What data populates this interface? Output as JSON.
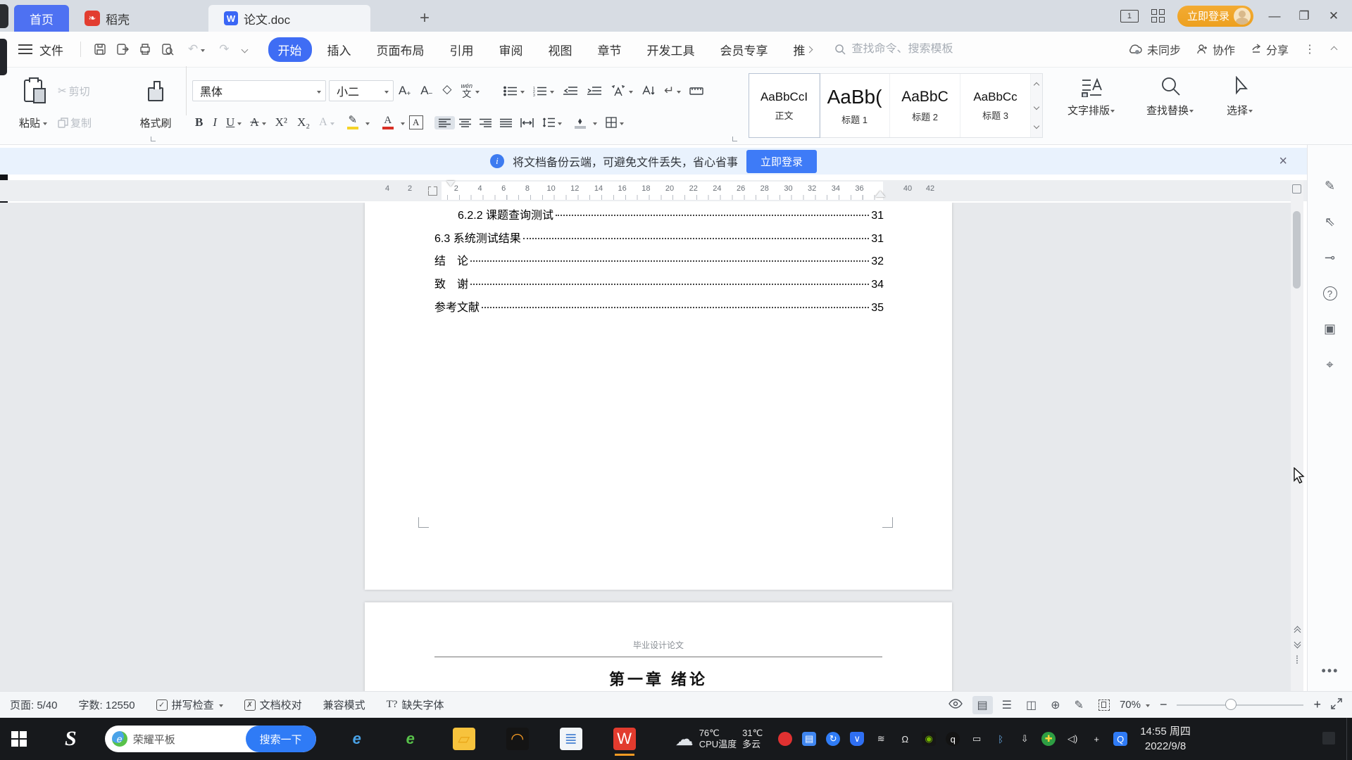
{
  "colors": {
    "accent": "#3f6df4",
    "login_orange": "#eda01f",
    "docer_red": "#e23d30",
    "wps_red": "#e23b2e",
    "notice_bg": "#e9f2fd",
    "taskbar_bg": "#17191c"
  },
  "tabbar": {
    "home": "首页",
    "docer": "稻壳",
    "doc_title": "论文.doc",
    "login": "立即登录"
  },
  "menubar": {
    "file": "文件",
    "tabs": [
      {
        "label": "开始",
        "cls": "active"
      },
      {
        "label": "插入",
        "cls": ""
      },
      {
        "label": "页面布局",
        "cls": ""
      },
      {
        "label": "引用",
        "cls": ""
      },
      {
        "label": "审阅",
        "cls": ""
      },
      {
        "label": "视图",
        "cls": ""
      },
      {
        "label": "章节",
        "cls": ""
      },
      {
        "label": "开发工具",
        "cls": ""
      },
      {
        "label": "会员专享",
        "cls": ""
      },
      {
        "label": "推",
        "cls": "truncated"
      }
    ],
    "search_placeholder": "查找命令、搜索模板",
    "sync": "未同步",
    "collab": "协作",
    "share": "分享"
  },
  "ribbon": {
    "paste": "粘贴",
    "cut": "剪切",
    "copy": "复制",
    "painter": "格式刷",
    "font_name": "黑体",
    "font_size": "小二",
    "pinyin_top": "wén",
    "pinyin_bottom": "文",
    "styles": [
      {
        "sample": "AaBbCcI",
        "label": "正文",
        "cls": "sel"
      },
      {
        "sample": "AaBb(",
        "label": "标题 1",
        "cls": "s1"
      },
      {
        "sample": "AaBbC",
        "label": "标题 2",
        "cls": "s2"
      },
      {
        "sample": "AaBbCc",
        "label": "标题 3",
        "cls": "s3"
      }
    ],
    "typeset": "文字排版",
    "find": "查找替换",
    "select": "选择"
  },
  "notice": {
    "info_text": "将文档备份云端，可避免文件丢失，省心省事",
    "login_button": "立即登录"
  },
  "ruler": {
    "left_nums": [
      "4",
      "2"
    ],
    "page_nums": [
      "2",
      "4",
      "6",
      "8",
      "10",
      "12",
      "14",
      "16",
      "18",
      "20",
      "22",
      "24",
      "26",
      "28",
      "30",
      "32",
      "34",
      "36"
    ],
    "right_nums": [
      "40",
      "42"
    ]
  },
  "document": {
    "toc": [
      {
        "title": "6.2.2  课题查询测试",
        "page": "31",
        "cls": "ind"
      },
      {
        "title": "6.3 系统测试结果",
        "page": "31",
        "cls": ""
      },
      {
        "title": "结　论",
        "page": "32",
        "cls": ""
      },
      {
        "title": "致　谢",
        "page": "34",
        "cls": ""
      },
      {
        "title": "参考文献",
        "page": "35",
        "cls": ""
      }
    ],
    "page2_header": "毕业设计论文",
    "page2_heading": "第一章  绪论"
  },
  "statusbar": {
    "page_info": "页面: 5/40",
    "word_count": "字数: 12550",
    "spell": "拼写检查",
    "proofread": "文档校对",
    "compat": "兼容模式",
    "missing_font": "缺失字体",
    "zoom_level": "70%",
    "view_icons": [
      {
        "name": "page-view-icon",
        "glyph": "▤",
        "cls": "sel"
      },
      {
        "name": "outline-view-icon",
        "glyph": "☰",
        "cls": ""
      },
      {
        "name": "read-layout-icon",
        "glyph": "◫",
        "cls": ""
      },
      {
        "name": "web-layout-icon",
        "glyph": "⊕",
        "cls": ""
      },
      {
        "name": "ink-annotation-icon",
        "glyph": "✎",
        "cls": ""
      }
    ]
  },
  "taskbar": {
    "device": "荣耀平板",
    "search_button": "搜索一下",
    "apps": [
      {
        "name": "taskbar-app-ie",
        "glyph": "e",
        "bg": "transparent",
        "color": "#4aa3e8",
        "cls": "italic"
      },
      {
        "name": "taskbar-app-browser",
        "glyph": "e",
        "bg": "transparent",
        "color": "#58c24a",
        "cls": "italic"
      },
      {
        "name": "taskbar-app-explorer",
        "glyph": "▱",
        "bg": "#f7c33d",
        "color": "#e8a416",
        "cls": ""
      },
      {
        "name": "taskbar-app-media",
        "glyph": "◠",
        "bg": "#141414",
        "color": "#f59a23",
        "cls": ""
      },
      {
        "name": "taskbar-app-notepad",
        "glyph": "≣",
        "bg": "#f2f5f8",
        "color": "#5b8fd6",
        "cls": ""
      },
      {
        "name": "taskbar-app-wps",
        "glyph": "W",
        "bg": "#e23b2e",
        "color": "#ffffff",
        "cls": "active"
      }
    ],
    "weather": {
      "cpu_temp": "76℃",
      "cpu_label": "CPU温度",
      "temp": "31℃",
      "cond": "多云"
    },
    "tray": [
      {
        "name": "tray-antivirus-icon",
        "glyph": "",
        "bg": "#e03131",
        "color": "#fff",
        "shape": "circle"
      },
      {
        "name": "tray-usb-tool-icon",
        "glyph": "▤",
        "bg": "#3f86f0",
        "color": "#fff",
        "shape": "round"
      },
      {
        "name": "tray-sync-icon",
        "glyph": "↻",
        "bg": "#2f7cf6",
        "color": "#fff",
        "shape": "circle"
      },
      {
        "name": "tray-security-shield-icon",
        "glyph": "∨",
        "bg": "#2f6ff2",
        "color": "#fff",
        "shape": "shield"
      },
      {
        "name": "tray-signal-icon",
        "glyph": "≋",
        "bg": "transparent",
        "color": "#e8e8e8",
        "shape": ""
      },
      {
        "name": "tray-bell-icon",
        "glyph": "Ω",
        "bg": "transparent",
        "color": "#e8e8e8",
        "shape": ""
      },
      {
        "name": "tray-nvidia-icon",
        "glyph": "◉",
        "bg": "#161616",
        "color": "#76b900",
        "shape": "round"
      },
      {
        "name": "tray-qq-icon",
        "glyph": "q",
        "bg": "#131313",
        "color": "#fff",
        "shape": "circle"
      },
      {
        "name": "tray-power-icon",
        "glyph": "▭",
        "bg": "transparent",
        "color": "#e8e8e8",
        "shape": ""
      },
      {
        "name": "tray-bluetooth-icon",
        "glyph": "ᛒ",
        "bg": "transparent",
        "color": "#6db4f2",
        "shape": ""
      },
      {
        "name": "tray-usb-eject-icon",
        "glyph": "⇩",
        "bg": "transparent",
        "color": "#e8e8e8",
        "shape": ""
      },
      {
        "name": "tray-duba-icon",
        "glyph": "✚",
        "bg": "#2e9e43",
        "color": "#ffd43b",
        "shape": "circle"
      },
      {
        "name": "tray-volume-icon",
        "glyph": "◁)",
        "bg": "transparent",
        "color": "#e8e8e8",
        "shape": ""
      },
      {
        "name": "tray-crosshair-icon",
        "glyph": "+",
        "bg": "transparent",
        "color": "#e8e8e8",
        "shape": ""
      },
      {
        "name": "tray-qq-browser-icon",
        "glyph": "Q",
        "bg": "#2f7bf6",
        "color": "#fff",
        "shape": "round"
      }
    ],
    "clock_time": "14:55 周四",
    "clock_date": "2022/9/8"
  },
  "rightpanel": {
    "icons": [
      {
        "name": "annotate-pen-icon",
        "glyph": "✎",
        "cls": ""
      },
      {
        "name": "select-cursor-icon",
        "glyph": "⇖",
        "cls": ""
      },
      {
        "name": "measure-icon",
        "glyph": "⊸",
        "cls": ""
      },
      {
        "name": "help-icon",
        "glyph": "?",
        "cls": "circled"
      },
      {
        "name": "image-to-text-icon",
        "glyph": "▣",
        "cls": ""
      },
      {
        "name": "quick-tool-icon",
        "glyph": "⌖",
        "cls": ""
      }
    ]
  }
}
